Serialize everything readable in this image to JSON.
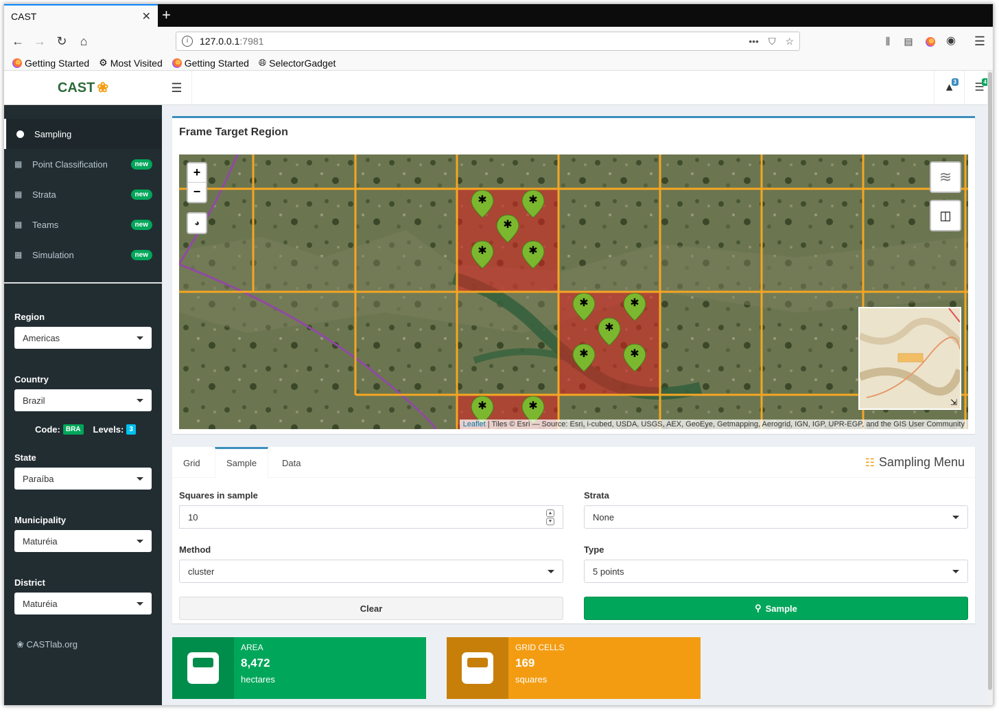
{
  "browser": {
    "tab_title": "CAST",
    "url_host": "127.0.0.1",
    "url_port": ":7981",
    "bookmarks": [
      "Getting Started",
      "Most Visited",
      "Getting Started",
      "SelectorGadget"
    ]
  },
  "app": {
    "logo_text": "CAST",
    "header_alerts_count": "3",
    "header_tasks_count": "4"
  },
  "sidebar": {
    "items": [
      {
        "label": "Sampling"
      },
      {
        "label": "Point Classification",
        "badge": "new"
      },
      {
        "label": "Strata",
        "badge": "new"
      },
      {
        "label": "Teams",
        "badge": "new"
      },
      {
        "label": "Simulation",
        "badge": "new"
      }
    ],
    "region": {
      "label": "Region",
      "value": "Americas"
    },
    "country": {
      "label": "Country",
      "value": "Brazil"
    },
    "code_label": "Code:",
    "code_value": "BRA",
    "levels_label": "Levels:",
    "levels_value": "3",
    "state": {
      "label": "State",
      "value": "Paraíba"
    },
    "municipality": {
      "label": "Municipality",
      "value": "Maturéia"
    },
    "district": {
      "label": "District",
      "value": "Maturéia"
    },
    "footer_link": "CASTlab.org"
  },
  "map_panel": {
    "title": "Frame Target Region",
    "attribution_link": "Leaflet",
    "attribution_text": " | Tiles © Esri — Source: Esri, i-cubed, USDA, USGS, AEX, GeoEye, Getmapping, Aerogrid, IGN, IGP, UPR-EGP, and the GIS User Community",
    "zoom_in": "+",
    "zoom_out": "−"
  },
  "sampling_menu": {
    "title": "Sampling Menu",
    "tabs": [
      "Grid",
      "Sample",
      "Data"
    ],
    "active_tab": "Sample",
    "squares_label": "Squares in sample",
    "squares_value": "10",
    "strata_label": "Strata",
    "strata_value": "None",
    "method_label": "Method",
    "method_value": "cluster",
    "type_label": "Type",
    "type_value": "5 points",
    "clear_button": "Clear",
    "sample_button": "Sample"
  },
  "stats": {
    "area": {
      "label": "AREA",
      "value": "8,472",
      "unit": "hectares",
      "color": "#00a65a",
      "icon_bg": "#008d4c"
    },
    "grid": {
      "label": "GRID CELLS",
      "value": "169",
      "unit": "squares",
      "color": "#f39c12",
      "icon_bg": "#c87f0a"
    }
  }
}
